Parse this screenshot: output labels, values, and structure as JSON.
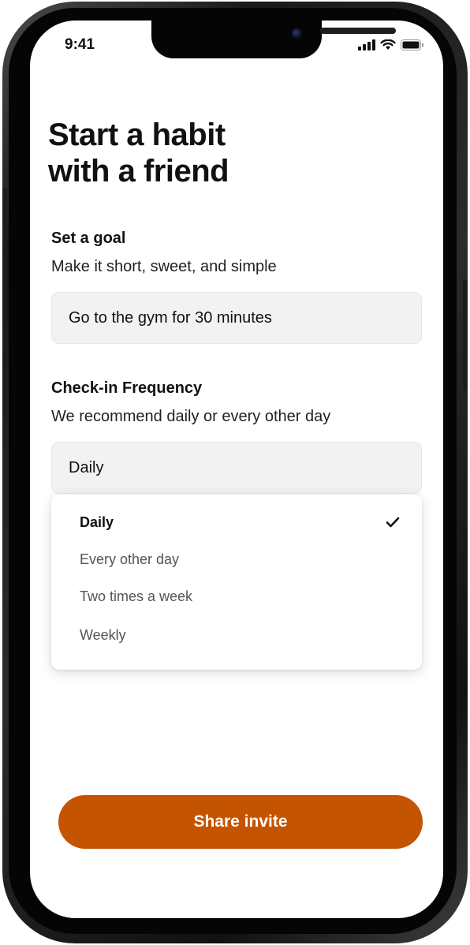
{
  "status_bar": {
    "time": "9:41",
    "icons": [
      "cellular-signal-icon",
      "wifi-icon",
      "battery-icon"
    ]
  },
  "page": {
    "title_line1": "Start a habit",
    "title_line2": "with a friend"
  },
  "goal": {
    "title": "Set a goal",
    "subtitle": "Make it short, sweet, and simple",
    "value": "Go to the gym for 30 minutes"
  },
  "frequency": {
    "title": "Check-in Frequency",
    "subtitle": "We recommend daily or every other day",
    "selected_value": "Daily",
    "options": [
      {
        "label": "Daily",
        "selected": true
      },
      {
        "label": "Every other day",
        "selected": false
      },
      {
        "label": "Two times a week",
        "selected": false
      },
      {
        "label": "Weekly",
        "selected": false
      }
    ],
    "checkmark_icon": "checkmark-icon"
  },
  "actions": {
    "share_label": "Share invite"
  },
  "colors": {
    "accent": "#c55400",
    "field_bg": "#f2f2f2",
    "text": "#111111"
  }
}
